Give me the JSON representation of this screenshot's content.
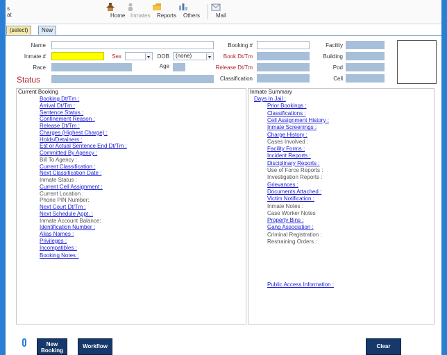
{
  "toolbar": {
    "left_glyphs": "s\nat",
    "buttons": [
      {
        "label": "Home",
        "icon": "home-icon"
      },
      {
        "label": "Inmates",
        "icon": "inmates-icon"
      },
      {
        "label": "Reports",
        "icon": "folder-icon"
      },
      {
        "label": "Others",
        "icon": "others-icon"
      },
      {
        "label": "Mail",
        "icon": "mail-icon"
      }
    ]
  },
  "tabs": {
    "select": "(select)",
    "new": "New"
  },
  "form": {
    "name": "Name",
    "inmate_no": "Inmate #",
    "sex": "Sex",
    "dob": "DOB",
    "dob_value": "(none)",
    "age": "Age",
    "race": "Race",
    "status": "Status",
    "booking_no": "Booking #",
    "book_dttm": "Book Dt/Tm",
    "release_dttm": "Release Dt/Tm",
    "classification": "Classification",
    "facility": "Facility",
    "building": "Building",
    "pod": "Pod",
    "cell": "Cell"
  },
  "current_booking": {
    "title": "Current Booking",
    "items": [
      {
        "text": "Booking Dt/Tm :",
        "link": true
      },
      {
        "text": "Arrival Dt/Tm :",
        "link": true
      },
      {
        "text": "Sentence Status :",
        "link": true
      },
      {
        "text": "Confinement Reason :",
        "link": true
      },
      {
        "text": "Release Dt/Tm :",
        "link": true
      },
      {
        "text": "Charges (Highest Charge) :",
        "link": true
      },
      {
        "text": "Holds/Detainers :",
        "link": true
      },
      {
        "text": "Est or Actual Sentence End Dt/Tm :",
        "link": true
      },
      {
        "text": "Committed By Agency :",
        "link": true
      },
      {
        "text": "Bill To Agency :",
        "link": false
      },
      {
        "text": "Current Classification :",
        "link": true
      },
      {
        "text": "Next Classification Date :",
        "link": true
      },
      {
        "text": "Inmate Status :",
        "link": false
      },
      {
        "text": "Current Cell Assignment :",
        "link": true
      },
      {
        "text": "Current Location :",
        "link": false
      },
      {
        "text": "Phone PIN Number:",
        "link": false
      },
      {
        "text": "Next Court Dt/Tm :",
        "link": true
      },
      {
        "text": "Next Schedule Appt. :",
        "link": true
      },
      {
        "text": "Inmate Account Balance:",
        "link": false
      },
      {
        "text": "Identification Number :",
        "link": true
      },
      {
        "text": "Alias Names :",
        "link": true
      },
      {
        "text": "Privileges :",
        "link": true
      },
      {
        "text": "Incompatibles :",
        "link": true
      },
      {
        "text": "Booking Notes :",
        "link": true
      }
    ]
  },
  "inmate_summary": {
    "title": "Inmate Summary",
    "items": [
      {
        "text": "Days In Jail :",
        "link": true
      },
      {
        "text": "Prior Bookings :",
        "link": true
      },
      {
        "text": "Classifications :",
        "link": true
      },
      {
        "text": "Cell Assignment History :",
        "link": true
      },
      {
        "text": "Inmate Screenings :",
        "link": true
      },
      {
        "text": "Charge History :",
        "link": true
      },
      {
        "text": "Cases Involved :",
        "link": false
      },
      {
        "text": "Facility Forms :",
        "link": true
      },
      {
        "text": "Incident Reports :",
        "link": true
      },
      {
        "text": "Disciplinary Reports :",
        "link": true
      },
      {
        "text": "Use of Force Reports :",
        "link": false
      },
      {
        "text": "Investigation Reports :",
        "link": false
      },
      {
        "text": "Grievances :",
        "link": true
      },
      {
        "text": "Documents Attached :",
        "link": true
      },
      {
        "text": "Victim Notification :",
        "link": true
      },
      {
        "text": "Inmate Notes :",
        "link": false
      },
      {
        "text": "Case Worker Notes",
        "link": false
      },
      {
        "text": "Property Bins :",
        "link": true
      },
      {
        "text": "Gang Association :",
        "link": true
      },
      {
        "text": "Criminal Registration :",
        "link": false
      },
      {
        "text": "Restraining Orders :",
        "link": false
      },
      {
        "text": "Public Access Information :",
        "link": true
      }
    ]
  },
  "buttons": {
    "new_booking_line1": "New",
    "new_booking_line2": "Booking",
    "workflow": "Workflow",
    "clear": "Clear"
  },
  "colors": {
    "accent": "#2a7fd4",
    "readonly_field": "#a7bfd8",
    "highlight_field": "#ffff00",
    "link": "#1a1ad6",
    "button": "#16386a"
  }
}
